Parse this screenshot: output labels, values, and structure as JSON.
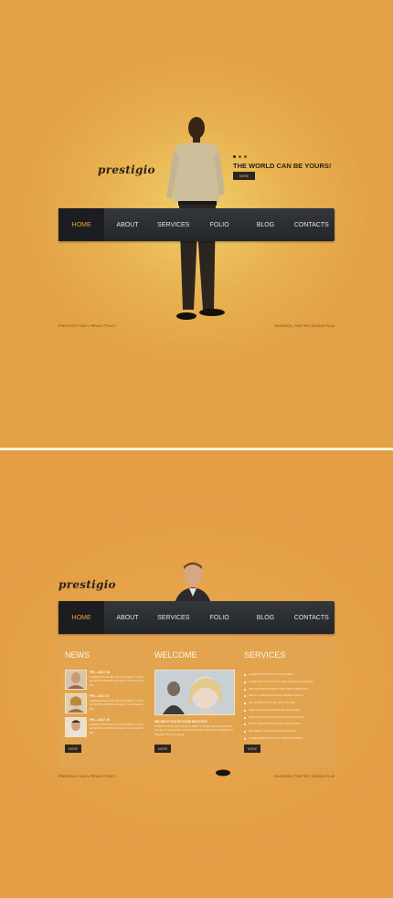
{
  "top": {
    "logo": "prestigio",
    "slider_dots": 3,
    "slider_active": 1,
    "tagline": "THE WORLD CAN BE YOURS!",
    "more_label": "MORE",
    "nav": [
      {
        "label": "HOME",
        "active": true
      },
      {
        "label": "ABOUT",
        "active": false
      },
      {
        "label": "SERVICES",
        "active": false
      },
      {
        "label": "FOLIO",
        "active": false
      },
      {
        "label": "BLOG",
        "active": false
      },
      {
        "label": "CONTACTS",
        "active": false
      }
    ],
    "footer_left": "PRESTIGIO © 2012 • PRIVACY POLICY",
    "footer_right": "FACEBOOK | TWITTER | GOOGLE PLUS"
  },
  "bottom": {
    "logo": "prestigio",
    "nav": [
      {
        "label": "HOME",
        "active": true
      },
      {
        "label": "ABOUT",
        "active": false
      },
      {
        "label": "SERVICES",
        "active": false
      },
      {
        "label": "FOLIO",
        "active": false
      },
      {
        "label": "BLOG",
        "active": false
      },
      {
        "label": "CONTACTS",
        "active": false
      }
    ],
    "news": {
      "title": "NEWS",
      "items": [
        {
          "date": "FRI., JULY 18",
          "text": "LOREM IPSUM DOLOR SITE AMET CONSECTETUR ADIPISCING ELIT. DUIS EGET NIBH"
        },
        {
          "date": "FRI., JULY 27",
          "text": "LOREM IPSUM DOLOR SITE AMET CONSECTETUR ADIPISCING ELIT. DUIS EGET NIBH"
        },
        {
          "date": "FRI., JULY 26",
          "text": "LOREM IPSUM DOLOR SITE AMET CONSECTETUR ADIPISCING ELIT. DUIS EGET NIBH"
        }
      ],
      "more_label": "MORE"
    },
    "welcome": {
      "title": "WELCOME",
      "subtitle": "WE HELP YOU IN YOUR SUCCESS",
      "text": "LOREM IPSUM DOLOR SITE AMET CONSECTETUR ADIPISCING ELIT. DUIS EGET NIBH IN DOLOR SODALES FERMENTUM EGET VITAE AUGUE.",
      "more_label": "MORE"
    },
    "services": {
      "title": "SERVICES",
      "items": [
        "LOREM IPSUM DOLOR SITE AMET",
        "NAME VOLUTE SITE CONSECTETUR ADIPISCING",
        "PELLENTESQUE EGET NIBH SED ADIPISCING",
        "VEL SIT AMET MOLESTIE CONSECTETUR",
        "NIT AUTHENTICE NISL DICTUM VEL",
        "NEM QUIS PELLENTESQUE NIBH EGET",
        "SED PORTTITOR CONSECTETUR DICTUM",
        "PROIN SEMPER MI IN NIBH ADIPISCING",
        "NIT AMET CONSECTETUR SODALES",
        "LOREM ADIPISCING ELIT SED TEMPORIS"
      ],
      "more_label": "MORE"
    },
    "footer_left": "PRESTIGIO © 2012 • PRIVACY POLICY",
    "footer_right": "FACEBOOK | TWITTER | GOOGLE PLUS"
  },
  "colors": {
    "background": "#e7a445",
    "nav_bg": "#2a2d31",
    "nav_active_text": "#f0a030",
    "dark_text": "#2b2219"
  }
}
